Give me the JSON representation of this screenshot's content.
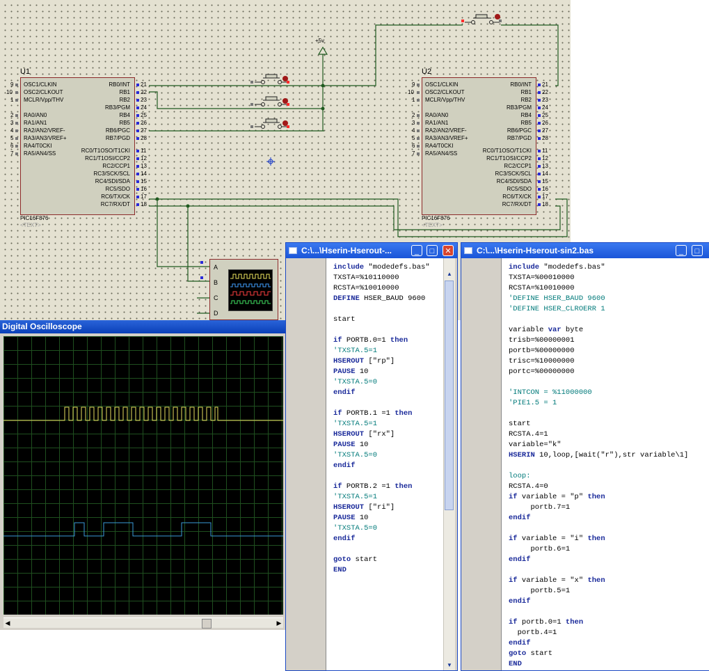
{
  "schematic": {
    "u1": {
      "ref": "U1",
      "part": "PIC16F876",
      "text": "<TEXT>"
    },
    "u2": {
      "ref": "U2",
      "part": "PIC16F876",
      "text": "<TEXT>"
    },
    "left_pins": [
      {
        "num": "9",
        "label": "OSC1/CLKIN"
      },
      {
        "num": "10",
        "label": "OSC2/CLKOUT"
      },
      {
        "num": "1",
        "label": "MCLR/Vpp/THV"
      },
      {
        "num": "2",
        "label": "RA0/AN0"
      },
      {
        "num": "3",
        "label": "RA1/AN1"
      },
      {
        "num": "4",
        "label": "RA2/AN2/VREF-"
      },
      {
        "num": "5",
        "label": "RA3/AN3/VREF+"
      },
      {
        "num": "6",
        "label": "RA4/T0CKI"
      },
      {
        "num": "7",
        "label": "RA5/AN4/SS"
      }
    ],
    "right_pins": [
      {
        "num": "21",
        "label": "RB0/INT"
      },
      {
        "num": "22",
        "label": "RB1"
      },
      {
        "num": "23",
        "label": "RB2"
      },
      {
        "num": "24",
        "label": "RB3/PGM"
      },
      {
        "num": "25",
        "label": "RB4"
      },
      {
        "num": "26",
        "label": "RB5"
      },
      {
        "num": "27",
        "label": "RB6/PGC"
      },
      {
        "num": "28",
        "label": "RB7/PGD"
      },
      {
        "num": "11",
        "label": "RC0/T1OSO/T1CKI"
      },
      {
        "num": "12",
        "label": "RC1/T1OSI/CCP2"
      },
      {
        "num": "13",
        "label": "RC2/CCP1"
      },
      {
        "num": "14",
        "label": "RC3/SCK/SCL"
      },
      {
        "num": "15",
        "label": "RC4/SDI/SDA"
      },
      {
        "num": "16",
        "label": "RC5/SDO"
      },
      {
        "num": "17",
        "label": "RC6/TX/CK"
      },
      {
        "num": "18",
        "label": "RC7/RX/DT"
      }
    ],
    "power_label": "+5v",
    "scope_channels": [
      "A",
      "B",
      "C",
      "D"
    ]
  },
  "oscilloscope": {
    "title": "Digital Oscilloscope",
    "colors": {
      "trace_a": "#e8e060",
      "trace_b": "#3a9ad8",
      "grid": "#1f4f1f"
    }
  },
  "editor_left": {
    "title": "C:\\...\\Hserin-Hserout-...",
    "lines": [
      [
        [
          "kw",
          "include"
        ],
        [
          "t",
          " \"modedefs.bas\""
        ]
      ],
      [
        [
          "t",
          "TXSTA=%10110000"
        ]
      ],
      [
        [
          "t",
          "RCSTA=%10010000"
        ]
      ],
      [
        [
          "kw",
          "DEFINE"
        ],
        [
          "t",
          " HSER_BAUD 9600"
        ]
      ],
      [
        [
          "t",
          ""
        ]
      ],
      [
        [
          "t",
          "start"
        ]
      ],
      [
        [
          "t",
          ""
        ]
      ],
      [
        [
          "kw",
          "if"
        ],
        [
          "t",
          " PORTB.0=1 "
        ],
        [
          "kw",
          "then"
        ]
      ],
      [
        [
          "cmt",
          "'TXSTA.5=1"
        ]
      ],
      [
        [
          "kw",
          "HSEROUT"
        ],
        [
          "t",
          " [\"rp\"]"
        ]
      ],
      [
        [
          "kw",
          "PAUSE"
        ],
        [
          "t",
          " 10"
        ]
      ],
      [
        [
          "cmt",
          "'TXSTA.5=0"
        ]
      ],
      [
        [
          "kw",
          "endif"
        ]
      ],
      [
        [
          "t",
          ""
        ]
      ],
      [
        [
          "kw",
          "if"
        ],
        [
          "t",
          " PORTB.1 =1 "
        ],
        [
          "kw",
          "then"
        ]
      ],
      [
        [
          "cmt",
          "'TXSTA.5=1"
        ]
      ],
      [
        [
          "kw",
          "HSEROUT"
        ],
        [
          "t",
          " [\"rx\"]"
        ]
      ],
      [
        [
          "kw",
          "PAUSE"
        ],
        [
          "t",
          " 10"
        ]
      ],
      [
        [
          "cmt",
          "'TXSTA.5=0"
        ]
      ],
      [
        [
          "kw",
          "endif"
        ]
      ],
      [
        [
          "t",
          ""
        ]
      ],
      [
        [
          "kw",
          "if"
        ],
        [
          "t",
          " PORTB.2 =1 "
        ],
        [
          "kw",
          "then"
        ]
      ],
      [
        [
          "cmt",
          "'TXSTA.5=1"
        ]
      ],
      [
        [
          "kw",
          "HSEROUT"
        ],
        [
          "t",
          " [\"ri\"]"
        ]
      ],
      [
        [
          "kw",
          "PAUSE"
        ],
        [
          "t",
          " 10"
        ]
      ],
      [
        [
          "cmt",
          "'TXSTA.5=0"
        ]
      ],
      [
        [
          "kw",
          "endif"
        ]
      ],
      [
        [
          "t",
          ""
        ]
      ],
      [
        [
          "kw",
          "goto"
        ],
        [
          "t",
          " start"
        ]
      ],
      [
        [
          "kw",
          "END"
        ]
      ]
    ]
  },
  "editor_right": {
    "title": "C:\\...\\Hserin-Hserout-sin2.bas",
    "lines": [
      [
        [
          "kw",
          "include"
        ],
        [
          "t",
          " \"modedefs.bas\""
        ]
      ],
      [
        [
          "t",
          "TXSTA=%00010000"
        ]
      ],
      [
        [
          "t",
          "RCSTA=%10010000"
        ]
      ],
      [
        [
          "cmt",
          "'DEFINE HSER_BAUD 9600"
        ]
      ],
      [
        [
          "cmt",
          "'DEFINE HSER_CLROERR 1"
        ]
      ],
      [
        [
          "t",
          ""
        ]
      ],
      [
        [
          "t",
          "variable "
        ],
        [
          "kw",
          "var"
        ],
        [
          "t",
          " byte"
        ]
      ],
      [
        [
          "t",
          "trisb=%00000001"
        ]
      ],
      [
        [
          "t",
          "portb=%00000000"
        ]
      ],
      [
        [
          "t",
          "trisc=%10000000"
        ]
      ],
      [
        [
          "t",
          "portc=%00000000"
        ]
      ],
      [
        [
          "t",
          ""
        ]
      ],
      [
        [
          "cmt",
          "'INTCON = %11000000"
        ]
      ],
      [
        [
          "cmt",
          "'PIE1.5 = 1"
        ]
      ],
      [
        [
          "t",
          ""
        ]
      ],
      [
        [
          "t",
          "start"
        ]
      ],
      [
        [
          "t",
          "RCSTA.4=1"
        ]
      ],
      [
        [
          "t",
          "variable=\"k\""
        ]
      ],
      [
        [
          "kw",
          "HSERIN"
        ],
        [
          "t",
          " 10,loop,[wait(\"r\"),str variable\\1]"
        ]
      ],
      [
        [
          "t",
          ""
        ]
      ],
      [
        [
          "cmt",
          "loop:"
        ]
      ],
      [
        [
          "t",
          "RCSTA.4=0"
        ]
      ],
      [
        [
          "kw",
          "if"
        ],
        [
          "t",
          " variable = \"p\" "
        ],
        [
          "kw",
          "then"
        ]
      ],
      [
        [
          "t",
          "     portb.7=1"
        ]
      ],
      [
        [
          "kw",
          "endif"
        ]
      ],
      [
        [
          "t",
          ""
        ]
      ],
      [
        [
          "kw",
          "if"
        ],
        [
          "t",
          " variable = \"i\" "
        ],
        [
          "kw",
          "then"
        ]
      ],
      [
        [
          "t",
          "     portb.6=1"
        ]
      ],
      [
        [
          "kw",
          "endif"
        ]
      ],
      [
        [
          "t",
          ""
        ]
      ],
      [
        [
          "kw",
          "if"
        ],
        [
          "t",
          " variable = \"x\" "
        ],
        [
          "kw",
          "then"
        ]
      ],
      [
        [
          "t",
          "     portb.5=1"
        ]
      ],
      [
        [
          "kw",
          "endif"
        ]
      ],
      [
        [
          "t",
          ""
        ]
      ],
      [
        [
          "kw",
          "if"
        ],
        [
          "t",
          " portb.0=1 "
        ],
        [
          "kw",
          "then"
        ]
      ],
      [
        [
          "t",
          "  portb.4=1"
        ]
      ],
      [
        [
          "kw",
          "endif"
        ]
      ],
      [
        [
          "kw",
          "goto"
        ],
        [
          "t",
          " start"
        ]
      ],
      [
        [
          "kw",
          "END"
        ]
      ]
    ]
  }
}
